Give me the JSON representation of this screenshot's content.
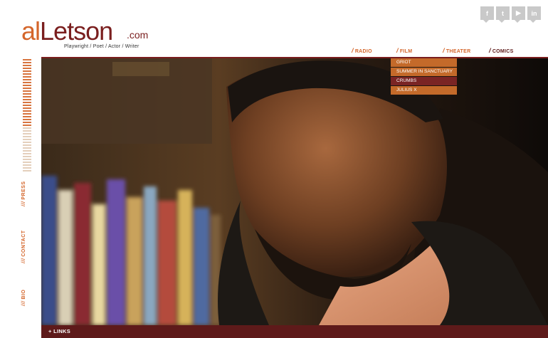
{
  "logo": {
    "first": "al",
    "rest": "Letson",
    "suffix": ".com",
    "tagline": "Playwright / Poet / Actor / Writer"
  },
  "social": [
    {
      "icon": "facebook-icon",
      "glyph": "f"
    },
    {
      "icon": "twitter-icon",
      "glyph": "t"
    },
    {
      "icon": "youtube-icon",
      "glyph": "▶"
    },
    {
      "icon": "linkedin-icon",
      "glyph": "in"
    }
  ],
  "nav": {
    "radio": "RADIO",
    "film": "FILM",
    "theater": "THEATER",
    "comics": "COMICS"
  },
  "film_menu": [
    "GRIOT",
    "SUMMER IN SANCTUARY",
    "CRUMBS",
    "JULIUS X"
  ],
  "side": {
    "press": "PRESS",
    "contact": "CONTACT",
    "bio": "BIO",
    "slash": "///"
  },
  "bottom": {
    "links": "+ LINKS"
  },
  "colors": {
    "accent": "#d4652a",
    "maroon": "#7a1e1e",
    "bar": "#5e1a1a"
  }
}
